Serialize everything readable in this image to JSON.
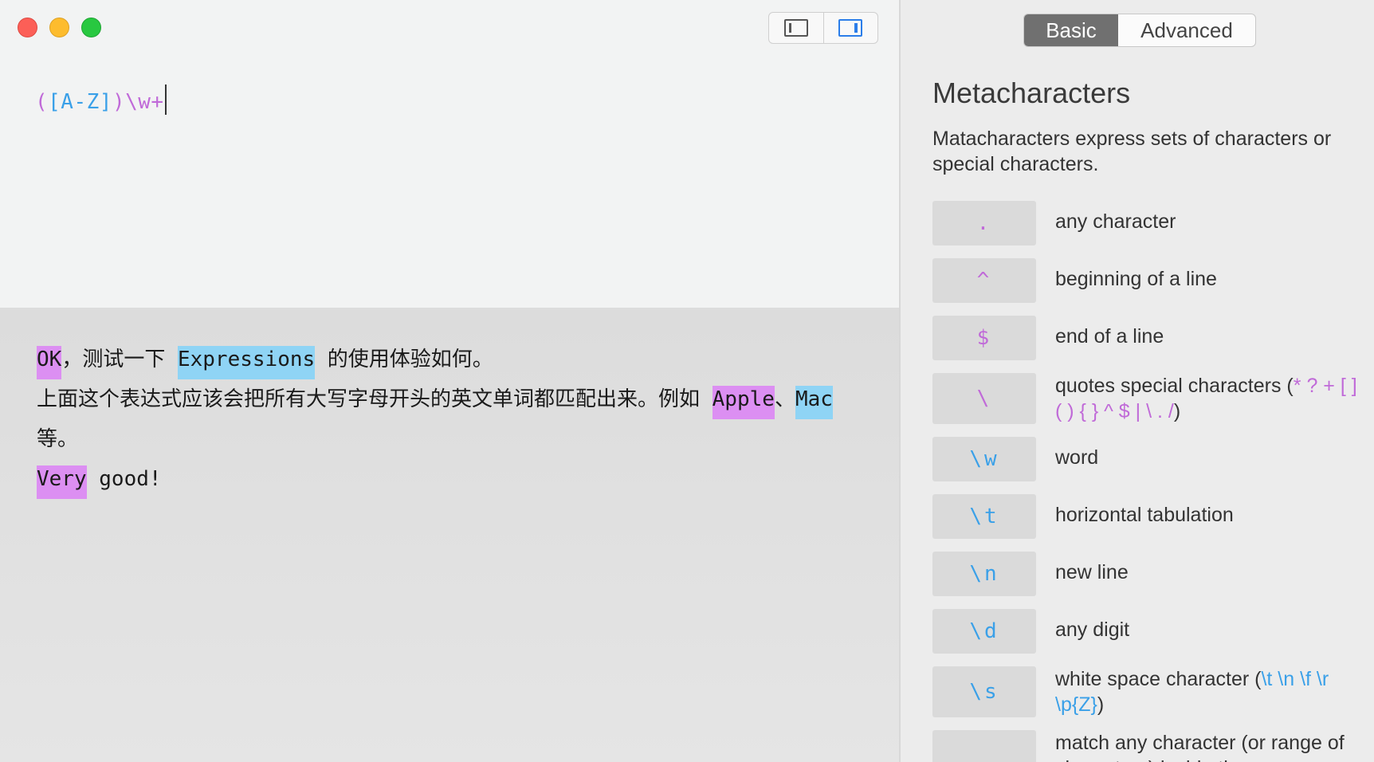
{
  "window": {
    "traffic_lights": [
      "close",
      "minimize",
      "zoom"
    ],
    "view_toggles": [
      {
        "icon": "left-sidebar-icon",
        "active": false
      },
      {
        "icon": "right-sidebar-icon",
        "active": true
      }
    ]
  },
  "editor": {
    "regex_parts": [
      "(",
      "[A-Z]",
      ")",
      "\\w+"
    ]
  },
  "results": {
    "line1": {
      "m1": "OK",
      "t1": "，测试一下 ",
      "m2": "Expressions",
      "t2": " 的使用体验如何。"
    },
    "line2": {
      "t1": "上面这个表达式应该会把所有大写字母开头的英文单词都匹配出来。例如 ",
      "m1": "Apple",
      "t2": "、",
      "m2": "Mac"
    },
    "line3": {
      "t1": "等。"
    },
    "line4": {
      "m1": "Very",
      "t1": " good!"
    }
  },
  "sidebar": {
    "tabs": {
      "basic": "Basic",
      "advanced": "Advanced",
      "active": "basic"
    },
    "title": "Metacharacters",
    "description": "Matacharacters express sets of characters or special characters.",
    "items": [
      {
        "symbol": ".",
        "label": "any character",
        "color": "magenta"
      },
      {
        "symbol": "^",
        "label": "beginning of a line",
        "color": "magenta"
      },
      {
        "symbol": "$",
        "label": "end of a line",
        "color": "magenta"
      },
      {
        "symbol": "\\",
        "label_prefix": "quotes special characters (",
        "label_codes": "* ? + [ ] ( ) { } ^ $ | \\ . /",
        "label_suffix": ")",
        "color": "magenta"
      },
      {
        "symbol": "\\w",
        "label": "word",
        "color": "blue"
      },
      {
        "symbol": "\\t",
        "label": "horizontal tabulation",
        "color": "blue"
      },
      {
        "symbol": "\\n",
        "label": "new line",
        "color": "blue"
      },
      {
        "symbol": "\\d",
        "label": "any digit",
        "color": "blue"
      },
      {
        "symbol": "\\s",
        "label_prefix": "white space character (",
        "label_codes": "\\t \\n \\f \\r \\p{Z}",
        "label_suffix": ")",
        "color": "blue"
      },
      {
        "symbol": "",
        "label": "match any character (or range of characters) inside the...",
        "color": "magenta"
      }
    ]
  },
  "colors": {
    "magenta": "#c06ad8",
    "blue": "#3aa0e8",
    "highlight_magenta": "#dc8ff2",
    "highlight_blue": "#8fd4f5"
  }
}
